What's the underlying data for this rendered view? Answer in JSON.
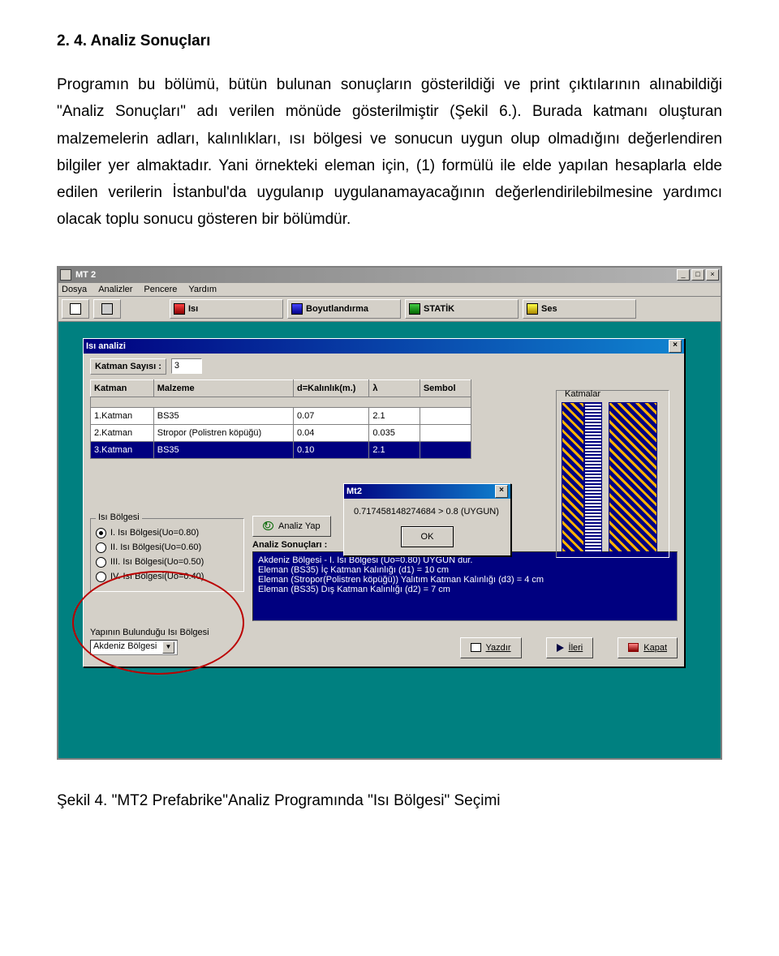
{
  "heading": "2. 4. Analiz Sonuçları",
  "paragraph": "Programın bu bölümü, bütün bulunan sonuçların gösterildiği ve print çıktılarının alınabildiği \"Analiz Sonuçları\" adı verilen mönüde gösterilmiştir (Şekil 6.). Burada katmanı oluşturan malzemelerin adları, kalınlıkları, ısı bölgesi ve sonucun uygun olup olmadığını değerlendiren bilgiler yer almaktadır. Yani örnekteki eleman için, (1) formülü ile elde yapılan hesaplarla elde edilen verilerin İstanbul'da uygulanıp uygulanamayacağının değerlendirilebilmesine yardımcı olacak toplu sonucu gösteren bir bölümdür.",
  "app": {
    "title": "MT 2",
    "menu": [
      "Dosya",
      "Analizler",
      "Pencere",
      "Yardım"
    ],
    "toolbtns": [
      "Isı",
      "Boyutlandırma",
      "STATİK",
      "Ses"
    ]
  },
  "dialog": {
    "title": "Isı analizi",
    "katman_sayisi_lbl": "Katman Sayısı :",
    "katman_sayisi_val": "3",
    "headers": [
      "Katman",
      "Malzeme",
      "d=Kalınlık(m.)",
      "λ",
      "Sembol"
    ],
    "rows": [
      {
        "k": "1.Katman",
        "m": "BS35",
        "d": "0.07",
        "l": "2.1",
        "s": ""
      },
      {
        "k": "2.Katman",
        "m": "Stropor (Polistren köpüğü)",
        "d": "0.04",
        "l": "0.035",
        "s": ""
      },
      {
        "k": "3.Katman",
        "m": "BS35",
        "d": "0.10",
        "l": "2.1",
        "s": ""
      }
    ],
    "katmalar_lbl": "Katmalar",
    "isi_grp": "Isı Bölgesi",
    "radios": [
      "I.   Isı Bölgesi(Uo=0.80)",
      "II.  Isı Bölgesi(Uo=0.60)",
      "III. Isı Bölgesi(Uo=0.50)",
      "IV. Isı Bölgesi(Uo=0.40)"
    ],
    "analiz_btn": "Analiz Yap",
    "analiz_son_lbl": "Analiz Sonuçları :",
    "analiz_lines": [
      "Akdeniz Bölgesi - I.   Isı Bölgesi (Uo=0.80) UYGUN dur.",
      "Eleman (BS35) İç Katman Kalınlığı (d1) = 10 cm",
      "Eleman (Stropor(Polistren köpüğü)) Yalıtım Katman Kalınlığı (d3) = 4 cm",
      "Eleman (BS35) Dış Katman Kalınlığı (d2) = 7 cm"
    ],
    "yapi_lbl": "Yapının Bulunduğu Isı Bölgesi",
    "yapi_val": "Akdeniz Bölgesi",
    "btns": {
      "yaz": "Yazdır",
      "ileri": "İleri",
      "kapat": "Kapat"
    }
  },
  "modal": {
    "title": "Mt2",
    "msg": "0.717458148274684 > 0.8 (UYGUN)",
    "ok": "OK"
  },
  "caption": "Şekil 4. \"MT2 Prefabrike\"Analiz Programında  \"Isı Bölgesi\" Seçimi"
}
